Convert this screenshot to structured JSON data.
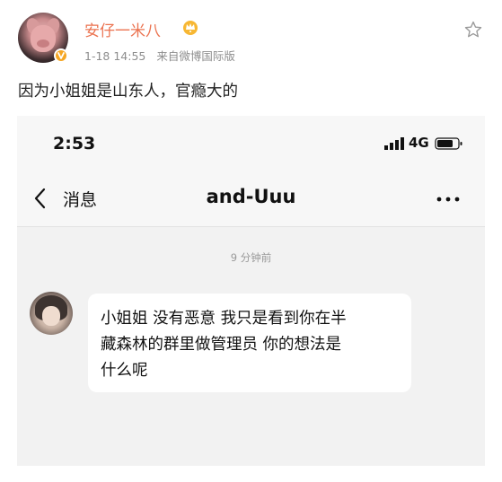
{
  "post": {
    "username": "安仔一米八",
    "date": "1-18 14:55",
    "source": "来自微博国际版",
    "text": "因为小姐姐是山东人，官瘾大的"
  },
  "screenshot": {
    "status_bar": {
      "time": "2:53",
      "network": "4G"
    },
    "nav": {
      "back_label": "消息",
      "title": "and-Uuu"
    },
    "chat": {
      "timestamp": "9 分钟前",
      "message_lines": [
        "小姐姐 没有恶意 我只是看到你在半",
        "藏森林的群里做管理员 你的想法是",
        "什么呢"
      ]
    }
  },
  "icons": {
    "avatar": "pig-avatar",
    "verify": "verified-badge-icon",
    "crown": "crown-icon",
    "star": "star-icon",
    "back": "chevron-left-icon",
    "more": "more-icon",
    "signal": "signal-icon",
    "battery": "battery-icon"
  },
  "colors": {
    "username": "#eb7350",
    "verify": "#f5a623",
    "meta": "#8e8e8e"
  }
}
